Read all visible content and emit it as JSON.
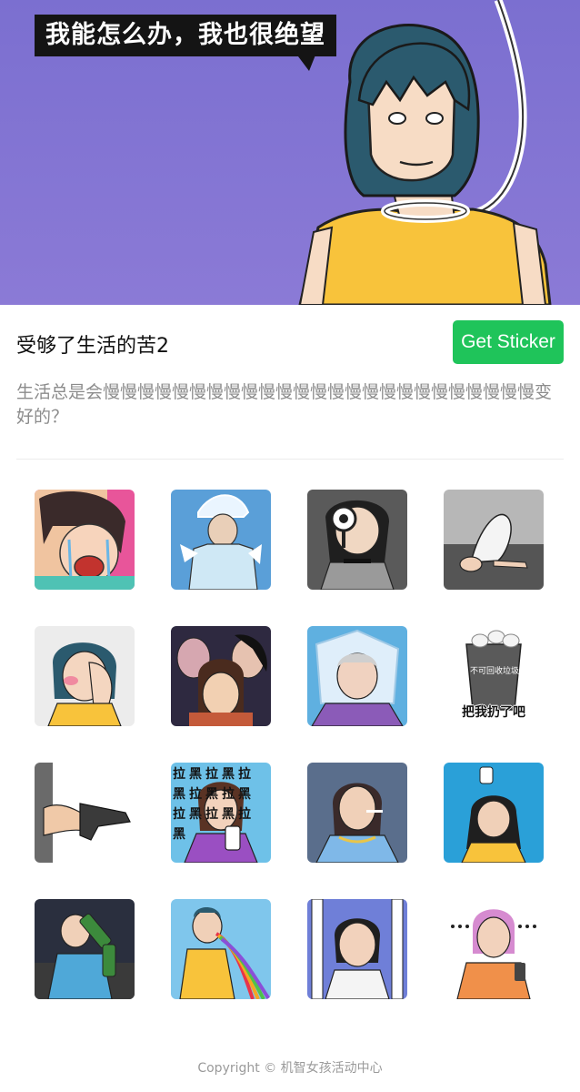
{
  "banner": {
    "speech_text": "我能怎么办，我也很绝望"
  },
  "sticker_pack": {
    "title": "受够了生活的苦2",
    "get_button_label": "Get Sticker",
    "description": "生活总是会慢慢慢慢慢慢慢慢慢慢慢慢慢慢慢慢慢慢慢慢慢慢慢慢慢变好的？"
  },
  "stickers": [
    {
      "name": "crying-woman",
      "text": ""
    },
    {
      "name": "ice-cold-woman",
      "text": ""
    },
    {
      "name": "magnifier-woman",
      "text": ""
    },
    {
      "name": "kneeling-woman",
      "text": ""
    },
    {
      "name": "facepalm-woman",
      "text": ""
    },
    {
      "name": "three-faces",
      "text": ""
    },
    {
      "name": "plastic-bag-grandma",
      "text": ""
    },
    {
      "name": "trash-bin",
      "text": "把我扔了吧",
      "bin_label": "不可回收垃圾"
    },
    {
      "name": "gun-hand",
      "text": ""
    },
    {
      "name": "block-woman",
      "text": "拉黑拉黑拉黑拉黑拉黑拉黑拉黑拉黑"
    },
    {
      "name": "smoking-woman",
      "text": ""
    },
    {
      "name": "water-splash-woman",
      "text": ""
    },
    {
      "name": "drinking-man",
      "text": ""
    },
    {
      "name": "rainbow-vomit-woman",
      "text": ""
    },
    {
      "name": "window-crying-woman",
      "text": ""
    },
    {
      "name": "phone-woman",
      "text": ""
    }
  ],
  "footer": {
    "copyright": "Copyright © 机智女孩活动中心"
  },
  "colors": {
    "accent_green": "#1fc45a",
    "banner_purple": "#7b6fd0"
  }
}
